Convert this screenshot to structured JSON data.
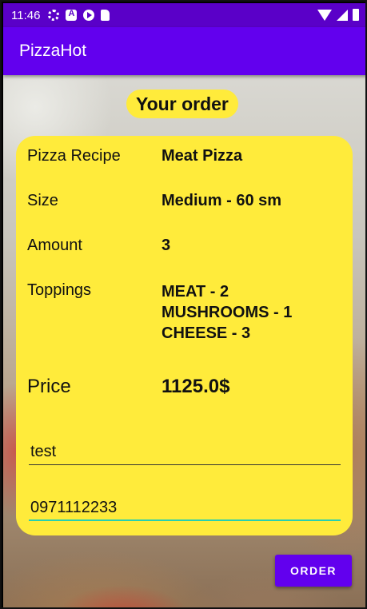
{
  "status_bar": {
    "time": "11:46",
    "icons_left": [
      "gear-icon",
      "a-icon",
      "play-icon",
      "sd-card-icon"
    ],
    "icons_right": [
      "wifi-icon",
      "signal-icon",
      "battery-icon"
    ]
  },
  "app_bar": {
    "title": "PizzaHot"
  },
  "order": {
    "heading": "Your order",
    "recipe": {
      "label": "Pizza Recipe",
      "value": "Meat Pizza"
    },
    "size": {
      "label": "Size",
      "value": "Medium - 60 sm"
    },
    "amount": {
      "label": "Amount",
      "value": "3"
    },
    "toppings": {
      "label": "Toppings",
      "items": [
        "MEAT - 2",
        "MUSHROOMS - 1",
        "CHEESE - 3"
      ]
    },
    "price": {
      "label": "Price",
      "value": "1125.0$"
    }
  },
  "form": {
    "name_value": "test",
    "phone_value": "0971112233"
  },
  "actions": {
    "order_label": "ORDER"
  },
  "colors": {
    "status_bar": "#5a00c8",
    "app_bar": "#6200ee",
    "card": "#ffeb3b",
    "focus_underline": "#26d0b0"
  }
}
